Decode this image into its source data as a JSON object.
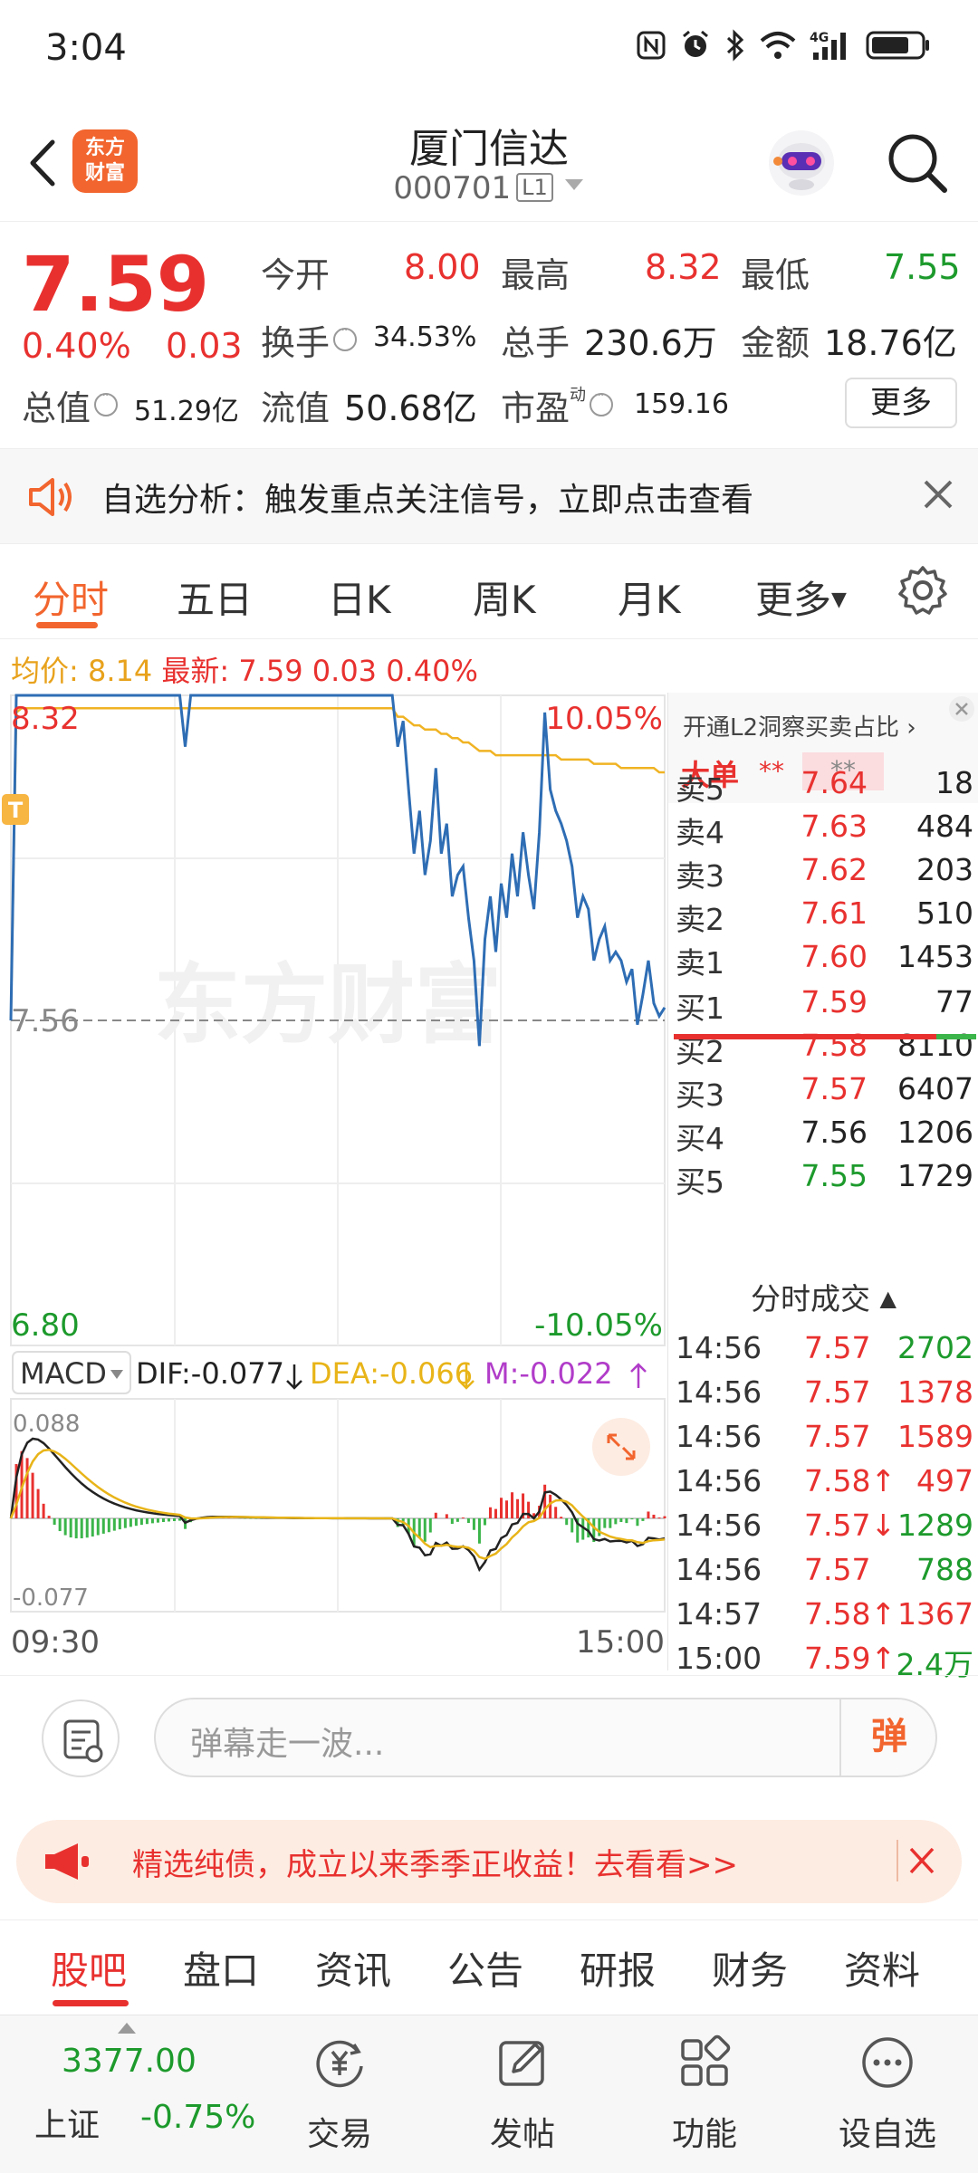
{
  "status_bar": {
    "time": "3:04"
  },
  "header": {
    "app_logo_line1": "东方",
    "app_logo_line2": "财富",
    "stock_name": "厦门信达",
    "stock_code": "000701",
    "level_badge": "L1"
  },
  "quote": {
    "price": "7.59",
    "pct_change": "0.40%",
    "abs_change": "0.03",
    "open_label": "今开",
    "open": "8.00",
    "high_label": "最高",
    "high": "8.32",
    "low_label": "最低",
    "low": "7.55",
    "turnover_label": "换手",
    "turnover": "34.53%",
    "volume_label": "总手",
    "volume": "230.6万",
    "amount_label": "金额",
    "amount": "18.76亿",
    "total_mv_label": "总值",
    "total_mv": "51.29亿",
    "float_mv_label": "流值",
    "float_mv": "50.68亿",
    "pe_label": "市盈",
    "pe_sup": "动",
    "pe": "159.16",
    "more_button": "更多"
  },
  "notice": {
    "text": "自选分析：触发重点关注信号，立即点击查看"
  },
  "chart_tabs": [
    "分时",
    "五日",
    "日K",
    "周K",
    "月K",
    "更多"
  ],
  "price_info": {
    "avg_label": "均价:",
    "avg": "8.14",
    "latest_label": "最新:",
    "latest": "7.59",
    "change": "0.03",
    "pct": "0.40%"
  },
  "chart_labels": {
    "max_price": "8.32",
    "max_pct": "10.05%",
    "prev_close": "7.56",
    "min_price": "6.80",
    "min_pct": "-10.05%",
    "t_marker": "T",
    "watermark": "东方财富",
    "start_time": "09:30",
    "end_time": "15:00"
  },
  "macd": {
    "selector": "MACD",
    "dif": "DIF:-0.077",
    "dea": "DEA:-0.066",
    "m": "M:-0.022",
    "top_label": "0.088",
    "bottom_label": "-0.077"
  },
  "chart_data": {
    "type": "line",
    "title": "",
    "xlabel": "",
    "ylabel": "",
    "x_range": [
      "09:30",
      "15:00"
    ],
    "ylim": [
      6.8,
      8.32
    ],
    "prev_close": 7.56,
    "series": [
      {
        "values": [
          7.56,
          8.32,
          8.32,
          8.32,
          8.32,
          8.32,
          8.32,
          8.32,
          8.32,
          8.32,
          8.32,
          8.32,
          8.32,
          8.32,
          8.32,
          8.32,
          8.32,
          8.32,
          8.32,
          8.32,
          8.32,
          8.32,
          8.32,
          8.32,
          8.32,
          8.32,
          8.32,
          8.32,
          8.32,
          8.32,
          8.32,
          8.32,
          8.2,
          8.32,
          8.32,
          8.32,
          8.32,
          8.32,
          8.32,
          8.32,
          8.32,
          8.32,
          8.32,
          8.32,
          8.32,
          8.32,
          8.32,
          8.32,
          8.32,
          8.32,
          8.32,
          8.32,
          8.32,
          8.32,
          8.32,
          8.32,
          8.32,
          8.32,
          8.32,
          8.32,
          8.32,
          8.32,
          8.32,
          8.32,
          8.32,
          8.32,
          8.32,
          8.32,
          8.32,
          8.32,
          8.32,
          8.2,
          8.26,
          8.1,
          7.95,
          8.05,
          7.9,
          7.98,
          8.15,
          7.95,
          8.02,
          7.85,
          7.9,
          7.92,
          7.8,
          7.7,
          7.5,
          7.75,
          7.85,
          7.72,
          7.88,
          7.8,
          7.95,
          7.85,
          8.0,
          7.9,
          7.82,
          8.0,
          8.28,
          8.1,
          8.05,
          8.02,
          7.98,
          7.92,
          7.8,
          7.85,
          7.82,
          7.7,
          7.75,
          7.78,
          7.7,
          7.72,
          7.7,
          7.65,
          7.68,
          7.55,
          7.62,
          7.7,
          7.6,
          7.57,
          7.59
        ]
      },
      {
        "values": [
          7.56,
          8.28,
          8.29,
          8.29,
          8.29,
          8.29,
          8.29,
          8.29,
          8.29,
          8.29,
          8.29,
          8.29,
          8.29,
          8.29,
          8.29,
          8.29,
          8.29,
          8.29,
          8.29,
          8.29,
          8.29,
          8.29,
          8.29,
          8.29,
          8.29,
          8.29,
          8.29,
          8.29,
          8.29,
          8.29,
          8.29,
          8.29,
          8.29,
          8.29,
          8.29,
          8.29,
          8.29,
          8.29,
          8.29,
          8.29,
          8.29,
          8.29,
          8.29,
          8.29,
          8.29,
          8.29,
          8.29,
          8.29,
          8.29,
          8.29,
          8.29,
          8.29,
          8.29,
          8.29,
          8.29,
          8.29,
          8.29,
          8.29,
          8.29,
          8.29,
          8.29,
          8.29,
          8.29,
          8.29,
          8.29,
          8.29,
          8.29,
          8.29,
          8.29,
          8.29,
          8.29,
          8.27,
          8.27,
          8.26,
          8.25,
          8.25,
          8.24,
          8.24,
          8.24,
          8.23,
          8.23,
          8.22,
          8.22,
          8.21,
          8.21,
          8.2,
          8.19,
          8.19,
          8.19,
          8.18,
          8.18,
          8.18,
          8.18,
          8.18,
          8.18,
          8.18,
          8.18,
          8.18,
          8.18,
          8.18,
          8.18,
          8.17,
          8.17,
          8.17,
          8.17,
          8.17,
          8.17,
          8.16,
          8.16,
          8.16,
          8.16,
          8.16,
          8.15,
          8.15,
          8.15,
          8.15,
          8.15,
          8.15,
          8.15,
          8.14,
          8.14
        ]
      }
    ]
  },
  "order_book": {
    "l2_text": "开通L2洞察买卖占比",
    "big_order_label": "大单",
    "big_order_stars": "**",
    "asks": [
      {
        "label": "卖5",
        "price": "7.64",
        "vol": "18",
        "color": "red"
      },
      {
        "label": "卖4",
        "price": "7.63",
        "vol": "484",
        "color": "red"
      },
      {
        "label": "卖3",
        "price": "7.62",
        "vol": "203",
        "color": "red"
      },
      {
        "label": "卖2",
        "price": "7.61",
        "vol": "510",
        "color": "red"
      },
      {
        "label": "卖1",
        "price": "7.60",
        "vol": "1453",
        "color": "red"
      }
    ],
    "bids": [
      {
        "label": "买1",
        "price": "7.59",
        "vol": "77",
        "color": "red"
      },
      {
        "label": "买2",
        "price": "7.58",
        "vol": "8110",
        "color": "red"
      },
      {
        "label": "买3",
        "price": "7.57",
        "vol": "6407",
        "color": "red"
      },
      {
        "label": "买4",
        "price": "7.56",
        "vol": "1206",
        "color": "dark"
      },
      {
        "label": "买5",
        "price": "7.55",
        "vol": "1729",
        "color": "green"
      }
    ],
    "trades_title": "分时成交",
    "trades": [
      {
        "time": "14:56",
        "price": "7.57",
        "vol": "2702",
        "vcolor": "green"
      },
      {
        "time": "14:56",
        "price": "7.57",
        "vol": "1378",
        "vcolor": "red"
      },
      {
        "time": "14:56",
        "price": "7.57",
        "vol": "1589",
        "vcolor": "red"
      },
      {
        "time": "14:56",
        "price": "7.58↑",
        "vol": "497",
        "vcolor": "red"
      },
      {
        "time": "14:56",
        "price": "7.57↓",
        "vol": "1289",
        "vcolor": "green"
      },
      {
        "time": "14:56",
        "price": "7.57",
        "vol": "788",
        "vcolor": "green"
      },
      {
        "time": "14:57",
        "price": "7.58↑",
        "vol": "1367",
        "vcolor": "red"
      },
      {
        "time": "15:00",
        "price": "7.59↑",
        "vol": "2.4万",
        "vcolor": "green"
      }
    ]
  },
  "danmaku": {
    "placeholder": "弹幕走一波...",
    "send": "弹"
  },
  "ad": {
    "text": "精选纯债，成立以来季季正收益！去看看>>"
  },
  "bottom_tabs": [
    "股吧",
    "盘口",
    "资讯",
    "公告",
    "研报",
    "财务",
    "资料"
  ],
  "bottom_nav": {
    "index_value": "3377.00",
    "index_name": "上证",
    "index_change": "-0.75%",
    "items": [
      "交易",
      "发帖",
      "功能",
      "设自选"
    ]
  },
  "colors": {
    "up": "#e8312f",
    "down": "#1d9a2c",
    "accent": "#f2652e",
    "price_line": "#2e6db4",
    "avg_line": "#f0b323"
  }
}
